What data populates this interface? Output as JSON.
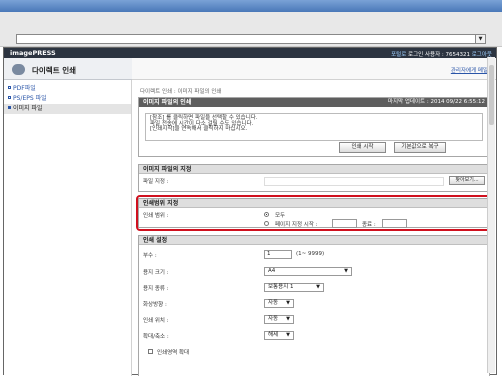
{
  "brand": "imagePRESS",
  "user": {
    "portal": "포털로",
    "login_text": "로그인 사용자 : 7654321",
    "logout": "로그아웃"
  },
  "app_title": "다이렉트 인쇄",
  "admin_link": "관리자에게 메일",
  "sidebar": {
    "items": [
      {
        "label": "PDF파일"
      },
      {
        "label": "PS/EPS 파일"
      },
      {
        "label": "이미지 파일"
      }
    ]
  },
  "breadcrumb": "다이렉트 인쇄 : 이미지 파일의 인쇄",
  "print_panel": {
    "title": "이미지 파일의 인쇄",
    "last_updated": "마지막 업데이트 : 2014 09/22 6:55:12",
    "message_lines": [
      "[참조] 를 클릭하면 파일을 선택할 수 있습니다.",
      "파일 전송에 시간이 다소 걸릴 수도 있습니다.",
      "[인쇄시작]을 연속해서 클릭하지 마십시오."
    ],
    "start_button": "인쇄 시작",
    "reset_button": "기본값으로 복구"
  },
  "file_panel": {
    "title": "이미지 파일의 지정",
    "file_label": "파일 지정 :",
    "browse_button": "찾아보기..."
  },
  "range_panel": {
    "title": "인쇄범위 지정",
    "range_label": "인쇄 범위 :",
    "all_label": "모두",
    "pages_label": "페이지 지정 시작 :",
    "end_label": "종료 :",
    "selected": "all"
  },
  "settings_panel": {
    "title": "인쇄 설정",
    "copies_label": "부수 :",
    "copies_value": "1",
    "copies_range": "(1~ 9999)",
    "paper_size_label": "용지 크기 :",
    "paper_size_value": "A4",
    "paper_type_label": "용지 종류 :",
    "paper_type_value": "보통용지 1",
    "orientation_label": "화상방향 :",
    "orientation_value": "자동",
    "position_label": "인쇄 위치 :",
    "position_value": "자동",
    "zoom_label": "확대/축소 :",
    "zoom_value": "해제",
    "enlarge_label": "인쇄영역 확대",
    "enlarge_checked": false
  }
}
